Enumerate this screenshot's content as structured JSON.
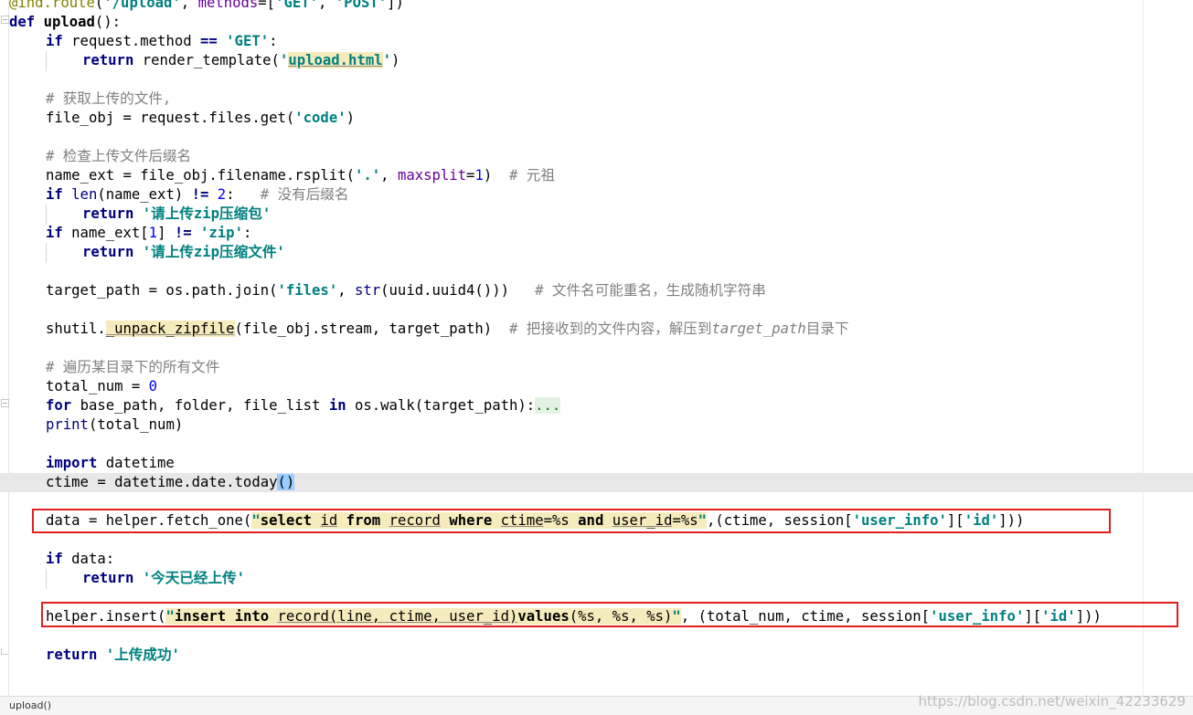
{
  "editor": {
    "lines": {
      "l0": {
        "a": "@",
        "b": "ind.route",
        "c": "(",
        "d": "'/upload'",
        "e": ", ",
        "f": "methods",
        "g": "=[",
        "h": "'GET'",
        "i": ", ",
        "j": "'POST'",
        "k": "])"
      },
      "l1": {
        "a": "def ",
        "b": "upload",
        "c": "():"
      },
      "l2": {
        "a": "if ",
        "b": "request.method ",
        "c": "==",
        "d": " ",
        "e": "'GET'",
        "f": ":"
      },
      "l3": {
        "a": "return ",
        "b": "render_template(",
        "c": "'",
        "d": "upload.html",
        "e": "'",
        "f": ")"
      },
      "l5": {
        "a": "# 获取上传的文件,"
      },
      "l6": {
        "a": "file_obj = request.files.get(",
        "b": "'code'",
        "c": ")"
      },
      "l8": {
        "a": "# 检查上传文件后缀名"
      },
      "l9": {
        "a": "name_ext = file_obj.filename.rsplit(",
        "b": "'.'",
        "c": ", ",
        "d": "maxsplit",
        "e": "=",
        "f": "1",
        "g": ")  ",
        "h": "# 元祖"
      },
      "l10": {
        "a": "if ",
        "b": "len",
        "c": "(name_ext) ",
        "d": "!=",
        "e": " ",
        "f": "2",
        "g": ":   ",
        "h": "# 没有后缀名"
      },
      "l11": {
        "a": "return ",
        "b": "'请上传zip压缩包'"
      },
      "l12": {
        "a": "if ",
        "b": "name_ext[",
        "c": "1",
        "d": "] ",
        "e": "!=",
        "f": " ",
        "g": "'zip'",
        "h": ":"
      },
      "l13": {
        "a": "return ",
        "b": "'请上传zip压缩文件'"
      },
      "l15": {
        "a": "target_path = os.path.join(",
        "b": "'files'",
        "c": ", ",
        "d": "str",
        "e": "(uuid.uuid4()))   ",
        "f": "# 文件名可能重名，生成随机字符串"
      },
      "l17": {
        "a": "shutil.",
        "b": "_unpack_zipfile",
        "c": "(file_obj.stream, target_path)  ",
        "d": "# 把接收到的文件内容，解压到",
        "e": "target_path",
        "f": "目录下"
      },
      "l19": {
        "a": "# 遍历某目录下的所有文件"
      },
      "l20": {
        "a": "total_num = ",
        "b": "0"
      },
      "l21": {
        "a": "for ",
        "b": "base_path, folder, file_list ",
        "c": "in ",
        "d": "os.walk(target_path):",
        "e": "..."
      },
      "l22": {
        "a": "print",
        "b": "(total_num)"
      },
      "l24": {
        "a": "import ",
        "b": "datetime"
      },
      "l25": {
        "a": "ctime = datetime.date.today",
        "b": "()"
      },
      "l27": {
        "a": "data = helper.fetch_one(",
        "b": "\"",
        "c": "select",
        "d": " ",
        "e": "id",
        "f": " ",
        "g": "from",
        "h": " ",
        "i": "record",
        "j": " ",
        "k": "where",
        "l": " ",
        "m": "ctime",
        "n": "=%s ",
        "o": "and",
        "p": " ",
        "q": "user_id",
        "r": "=%s",
        "s": "\"",
        "t": ",(ctime, session[",
        "u": "'user_info'",
        "v": "][",
        "w": "'id'",
        "x": "]))"
      },
      "l29": {
        "a": "if ",
        "b": "data:"
      },
      "l30": {
        "a": "return ",
        "b": "'今天已经上传'"
      },
      "l32": {
        "a": "helper.insert(",
        "b": "\"",
        "c": "insert",
        "d": " ",
        "e": "into",
        "f": " ",
        "g": "record(line, ctime, user_id)",
        "h": "values",
        "i": "(%s, %s, %s)",
        "j": "\"",
        "k": ", (total_num, ctime, session[",
        "l": "'user_info'",
        "m": "][",
        "n": "'id'",
        "o": "]))"
      },
      "l34": {
        "a": "return ",
        "b": "'上传成功'"
      }
    }
  },
  "status_bar": {
    "breadcrumb": "upload()"
  },
  "watermark": "https://blog.csdn.net/weixin_42233629",
  "colors": {
    "keyword": "#000080",
    "string": "#008080",
    "number": "#0000ff",
    "comment": "#808080",
    "decorator": "#808000",
    "param": "#660099",
    "highlight": "#f6ebbc",
    "caret_line": "#e8e8e8",
    "box": "#e02020"
  }
}
